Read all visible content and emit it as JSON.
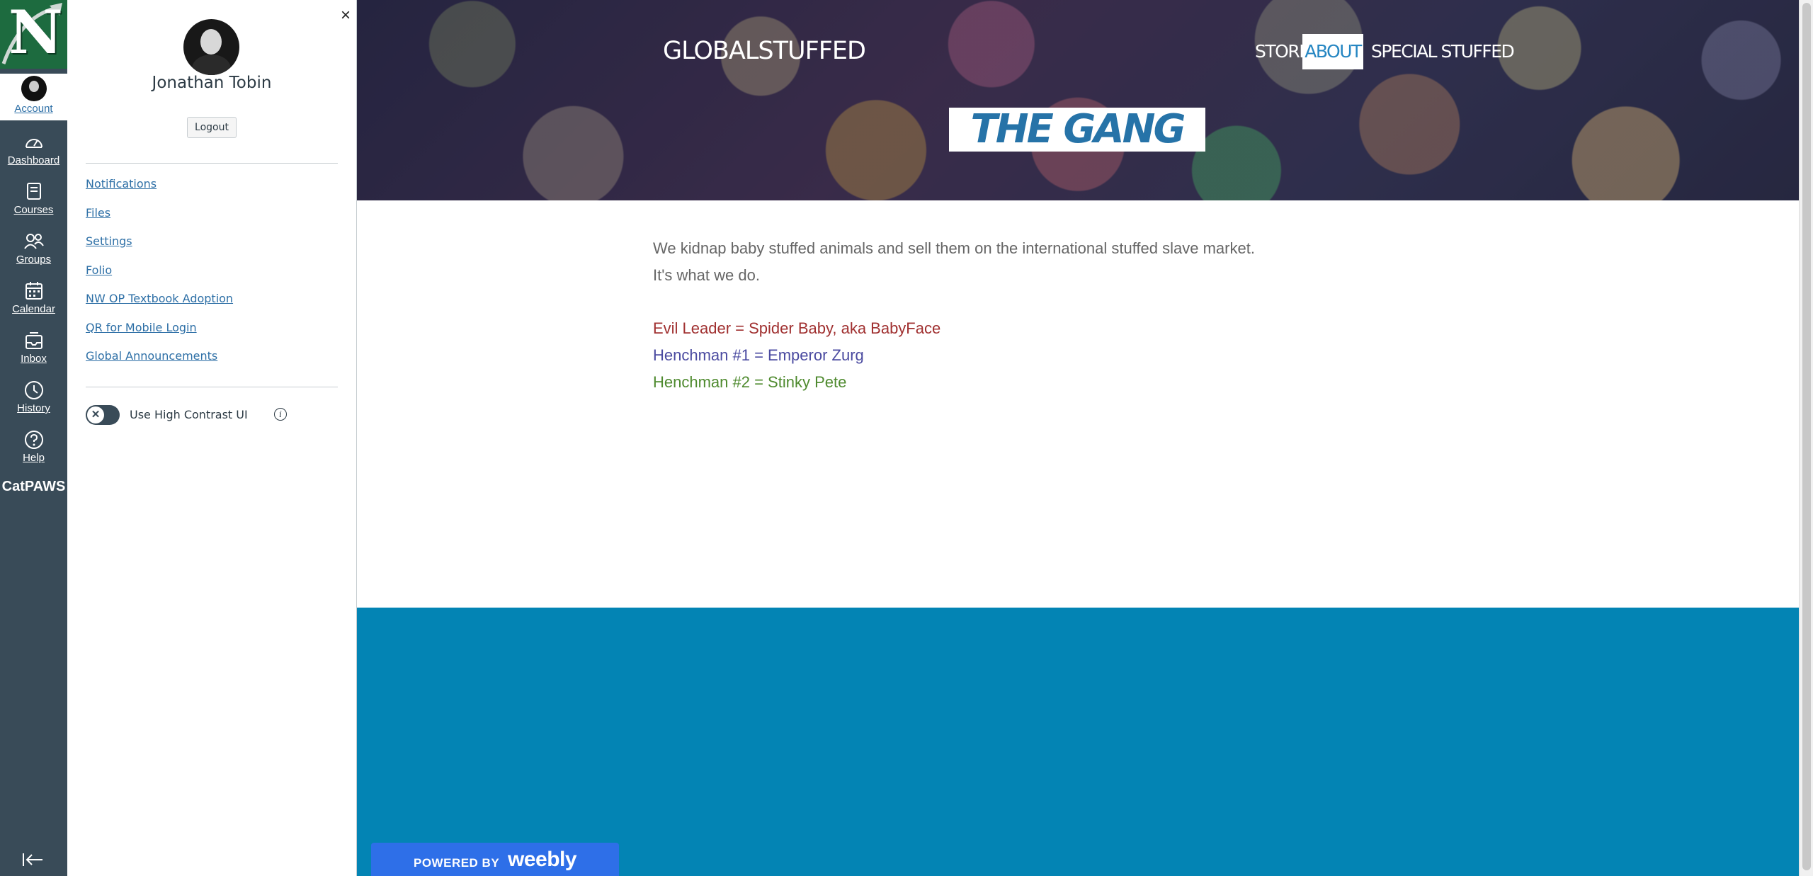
{
  "colors": {
    "rail_bg": "#394b58",
    "logo_green": "#1d6b3f",
    "link_blue": "#2d6fa6",
    "footer_blue": "#0384b4",
    "gang_blue": "#2673a8",
    "weebly_blue": "#2e6fe8",
    "red_line": "#a03030",
    "blue_line": "#4a4aa0",
    "green_line": "#4e8a2e"
  },
  "rail": {
    "logo_letter": "N",
    "brand_text": "CatPAWS",
    "items": [
      {
        "label": "Account",
        "icon": "account-avatar"
      },
      {
        "label": "Dashboard",
        "icon": "dashboard-icon"
      },
      {
        "label": "Courses",
        "icon": "courses-icon"
      },
      {
        "label": "Groups",
        "icon": "groups-icon"
      },
      {
        "label": "Calendar",
        "icon": "calendar-icon"
      },
      {
        "label": "Inbox",
        "icon": "inbox-icon"
      },
      {
        "label": "History",
        "icon": "history-icon"
      },
      {
        "label": "Help",
        "icon": "help-icon"
      }
    ]
  },
  "tray": {
    "close_label": "×",
    "user_name": "Jonathan Tobin",
    "logout_label": "Logout",
    "links": [
      "Notifications",
      "Files",
      "Settings",
      "Folio",
      "NW OP Textbook Adoption",
      "QR for Mobile Login",
      "Global Announcements"
    ],
    "high_contrast_label": "Use High Contrast UI",
    "toggle_knob": "✕",
    "info_glyph": "i"
  },
  "site": {
    "title": "GLOBALSTUFFED",
    "nav": [
      "STORE",
      "ABOUT",
      "SPECIAL STUFFED"
    ],
    "hero_heading": "THE GANG",
    "intro_line1": "We kidnap baby stuffed animals and sell them on the international stuffed slave market.",
    "intro_line2": "It's what we do.",
    "gang": [
      "Evil Leader = Spider Baby, aka BabyFace",
      "Henchman #1 = Emperor Zurg",
      "Henchman #2 = Stinky Pete"
    ],
    "powered_by": "POWERED BY",
    "powered_brand": "weebly"
  }
}
